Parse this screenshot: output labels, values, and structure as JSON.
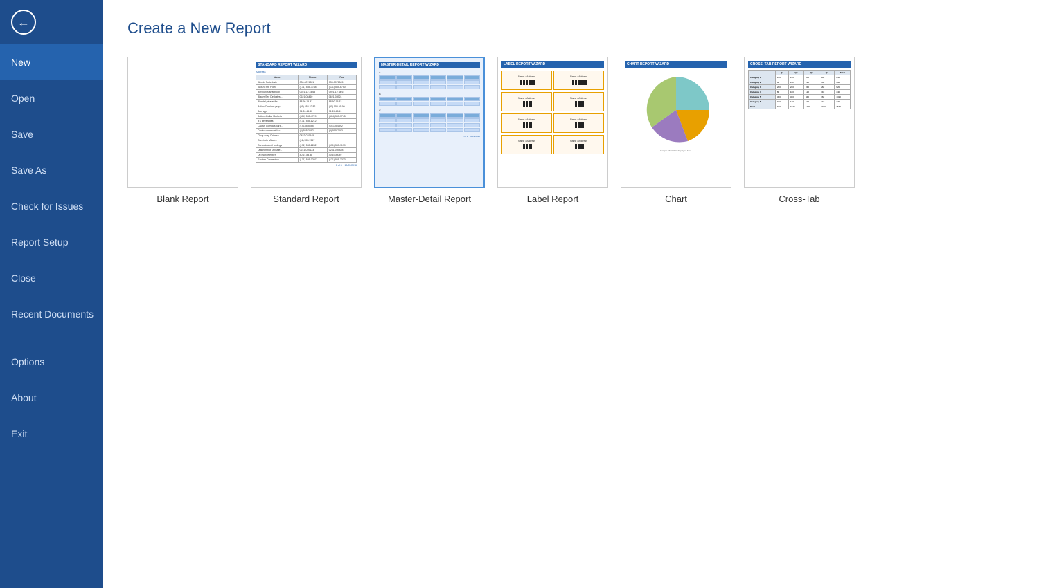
{
  "sidebar": {
    "items": [
      {
        "id": "new",
        "label": "New",
        "active": true
      },
      {
        "id": "open",
        "label": "Open",
        "active": false
      },
      {
        "id": "save",
        "label": "Save",
        "active": false
      },
      {
        "id": "save-as",
        "label": "Save As",
        "active": false
      },
      {
        "id": "check-for-issues",
        "label": "Check for Issues",
        "active": false
      },
      {
        "id": "report-setup",
        "label": "Report Setup",
        "active": false
      },
      {
        "id": "close",
        "label": "Close",
        "active": false
      },
      {
        "id": "recent-documents",
        "label": "Recent Documents",
        "active": false
      },
      {
        "id": "options",
        "label": "Options",
        "active": false
      },
      {
        "id": "about",
        "label": "About",
        "active": false
      },
      {
        "id": "exit",
        "label": "Exit",
        "active": false
      }
    ]
  },
  "main": {
    "title": "Create a New Report",
    "templates": [
      {
        "id": "blank",
        "label": "Blank Report",
        "selected": false
      },
      {
        "id": "standard",
        "label": "Standard Report",
        "selected": false
      },
      {
        "id": "master-detail",
        "label": "Master-Detail Report",
        "selected": true
      },
      {
        "id": "label",
        "label": "Label Report",
        "selected": false
      },
      {
        "id": "chart",
        "label": "Chart",
        "selected": false
      },
      {
        "id": "cross-tab",
        "label": "Cross-Tab",
        "selected": false
      }
    ]
  },
  "colors": {
    "sidebar_bg": "#1e4d8c",
    "accent": "#2563ae",
    "title_color": "#1e4d8c"
  }
}
